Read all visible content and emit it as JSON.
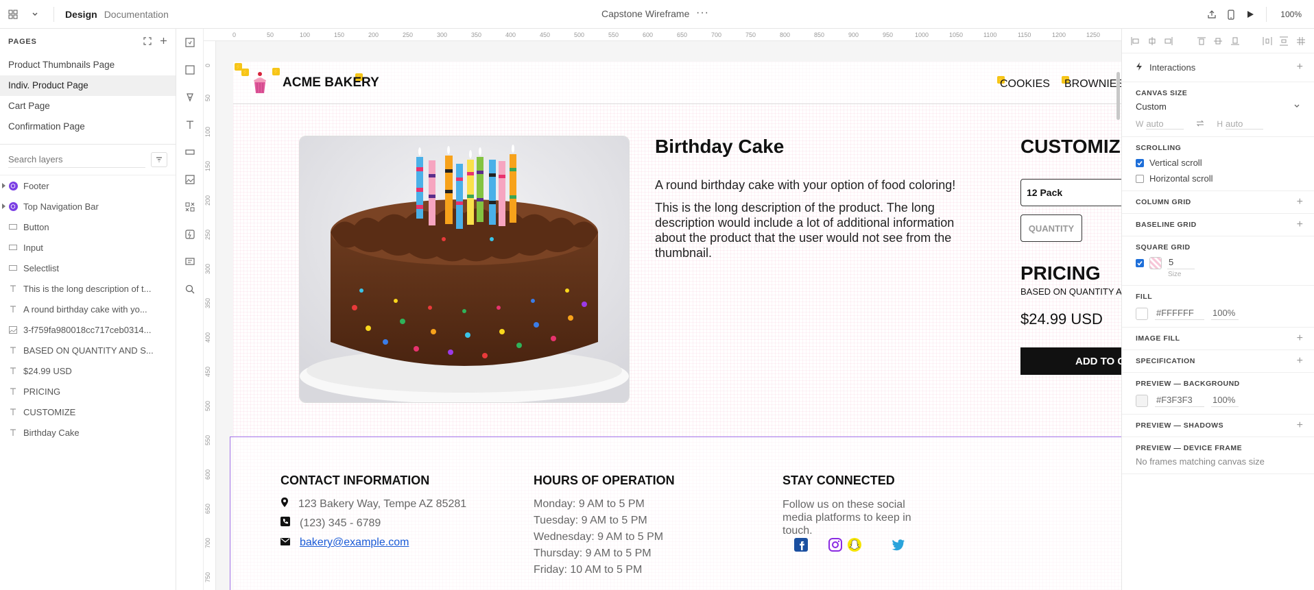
{
  "topbar": {
    "mode_design": "Design",
    "mode_documentation": "Documentation",
    "doc_title": "Capstone Wireframe",
    "more": "···",
    "zoom": "100%"
  },
  "pages": {
    "header": "PAGES",
    "items": [
      {
        "label": "Product Thumbnails Page"
      },
      {
        "label": "Indiv. Product Page",
        "active": true
      },
      {
        "label": "Cart Page"
      },
      {
        "label": "Confirmation Page"
      }
    ]
  },
  "layers": {
    "search_placeholder": "Search layers",
    "items": [
      {
        "label": "Footer",
        "icon": "component-icon"
      },
      {
        "label": "Top Navigation Bar",
        "icon": "component-icon"
      },
      {
        "label": "Button",
        "icon": "rectangle-icon"
      },
      {
        "label": "Input",
        "icon": "rectangle-icon"
      },
      {
        "label": "Selectlist",
        "icon": "rectangle-icon"
      },
      {
        "label": "This is the long description of t...",
        "icon": "text-icon"
      },
      {
        "label": "A round birthday cake with yo...",
        "icon": "text-icon"
      },
      {
        "label": "3-f759fa980018cc717ceb0314...",
        "icon": "image-icon"
      },
      {
        "label": "BASED ON QUANTITY AND S...",
        "icon": "text-icon"
      },
      {
        "label": "$24.99 USD",
        "icon": "text-icon"
      },
      {
        "label": "PRICING",
        "icon": "text-icon"
      },
      {
        "label": "CUSTOMIZE",
        "icon": "text-icon"
      },
      {
        "label": "Birthday Cake",
        "icon": "text-icon"
      }
    ]
  },
  "ruler": {
    "top": [
      "0",
      "50",
      "100",
      "150",
      "200",
      "250",
      "300",
      "350",
      "400",
      "450",
      "500",
      "550",
      "600",
      "650",
      "700",
      "750",
      "800",
      "850",
      "900",
      "950",
      "1000",
      "1050",
      "1100",
      "1150",
      "1200",
      "1250"
    ],
    "left": [
      "0",
      "50",
      "100",
      "150",
      "200",
      "250",
      "300",
      "350",
      "400",
      "450",
      "500",
      "550",
      "600",
      "650",
      "700",
      "750"
    ]
  },
  "artboard": {
    "brand": "ACME BAKERY",
    "nav": [
      "COOKIES",
      "BROWNIES"
    ],
    "product": {
      "title": "Birthday Cake",
      "short_desc": "A round birthday cake with your option of food coloring!",
      "long_desc": "This is the long description of the product. The long description would include a lot of additional information about the product that the user would not see from the thumbnail.",
      "customize_title": "CUSTOMIZE",
      "pack_option": "12 Pack",
      "quantity_placeholder": "QUANTITY",
      "pricing_title": "PRICING",
      "pricing_sub": "BASED ON QUANTITY A",
      "price": "$24.99 USD",
      "add_button": "ADD TO C"
    },
    "footer": {
      "contact_title": "CONTACT INFORMATION",
      "address": "123 Bakery Way, Tempe AZ 85281",
      "phone": "(123) 345 - 6789",
      "email": "bakery@example.com",
      "hours_title": "HOURS OF OPERATION",
      "hours": [
        "Monday: 9 AM to 5 PM",
        "Tuesday: 9 AM to 5 PM",
        "Wednesday: 9 AM to 5 PM",
        "Thursday: 9 AM to 5 PM",
        "Friday: 10 AM to 5 PM"
      ],
      "social_title": "STAY CONNECTED",
      "social_text": "Follow us on these social media platforms to keep in touch.",
      "social_icons": [
        "facebook-icon",
        "instagram-icon",
        "snapchat-icon",
        "twitter-icon"
      ],
      "social_colors": {
        "facebook": "#1a4fa0",
        "instagram": "#8a2be2",
        "snapchat": "#f5e400",
        "twitter": "#2aa3db"
      }
    }
  },
  "inspector": {
    "interactions": "Interactions",
    "canvas_size_label": "CANVAS SIZE",
    "canvas_size_value": "Custom",
    "w_label": "W",
    "w_value": "auto",
    "h_label": "H",
    "h_value": "auto",
    "scrolling_label": "SCROLLING",
    "vertical_scroll": "Vertical scroll",
    "vertical_checked": true,
    "horizontal_scroll": "Horizontal scroll",
    "horizontal_checked": false,
    "column_grid": "COLUMN GRID",
    "baseline_grid": "BASELINE GRID",
    "square_grid": "SQUARE GRID",
    "square_grid_size": "5",
    "size_caption": "Size",
    "fill_label": "FILL",
    "fill_hex": "#FFFFFF",
    "fill_opacity": "100%",
    "image_fill": "IMAGE FILL",
    "specification": "SPECIFICATION",
    "preview_bg_label": "PREVIEW — BACKGROUND",
    "preview_bg_hex": "#F3F3F3",
    "preview_bg_opacity": "100%",
    "preview_shadows": "PREVIEW — SHADOWS",
    "preview_device_frame": "PREVIEW — DEVICE FRAME",
    "no_frames": "No frames matching canvas size"
  },
  "colors": {
    "accent_blue": "#1e6fd9",
    "component_purple": "#7b3fe4",
    "footer_border": "#a271e8"
  }
}
